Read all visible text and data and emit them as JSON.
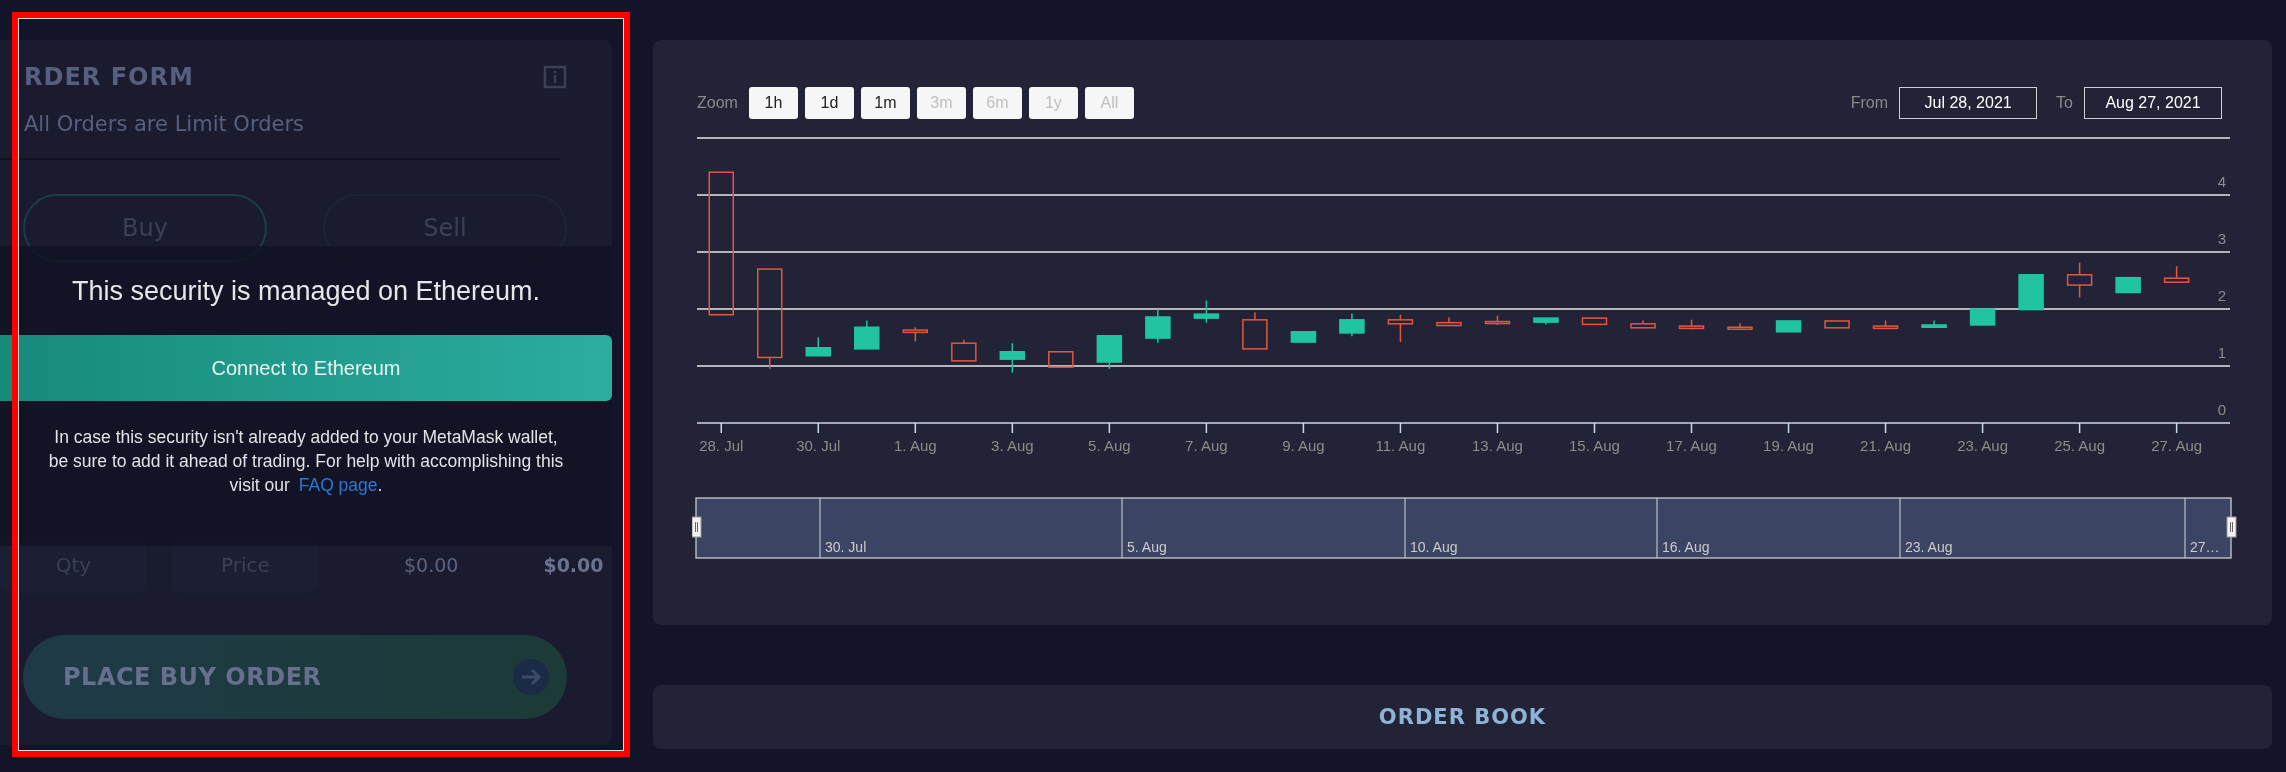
{
  "order_form": {
    "title": "RDER FORM",
    "subtitle": "All Orders are Limit Orders",
    "tabs": [
      {
        "label": "Buy",
        "selected": true
      },
      {
        "label": "Sell",
        "selected": false
      }
    ],
    "quantity": {
      "placeholder": "Qty"
    },
    "price": {
      "placeholder": "Price"
    },
    "commission": "$0.00",
    "total": "$0.00",
    "submit": {
      "label": "PLACE BUY ORDER",
      "disabled": true
    }
  },
  "network_prompt": {
    "title": "This security is managed on Ethereum.",
    "button": "Connect to Ethereum",
    "message": "In case this security isn't already added to your MetaMask wallet, be sure to add it ahead of trading. For help with accomplishing this visit our",
    "link": "FAQ page",
    "after_link": "."
  },
  "chart": {
    "zoom_label": "Zoom",
    "zoom_buttons": [
      {
        "label": "1h",
        "disabled": false
      },
      {
        "label": "1d",
        "disabled": false
      },
      {
        "label": "1m",
        "disabled": false
      },
      {
        "label": "3m",
        "disabled": true
      },
      {
        "label": "6m",
        "disabled": true
      },
      {
        "label": "1y",
        "disabled": true
      },
      {
        "label": "All",
        "disabled": true
      }
    ],
    "from_label": "From",
    "from": "Jul 28, 2021",
    "to_label": "To",
    "to": "Aug 27, 2021",
    "chart_data": {
      "type": "candlestick",
      "grid": true,
      "ylim": [
        0,
        5
      ],
      "categories": [
        "28. Jul",
        null,
        "30. Jul",
        null,
        "1. Aug",
        null,
        "3. Aug",
        null,
        "5. Aug",
        null,
        "7. Aug",
        null,
        "9. Aug",
        null,
        "11. Aug",
        null,
        "13. Aug",
        null,
        "15. Aug",
        null,
        "17. Aug",
        null,
        "19. Aug",
        null,
        "21. Aug",
        null,
        "23. Aug",
        null,
        "25. Aug",
        null,
        "27. Aug"
      ],
      "yticks": [
        0,
        1,
        2,
        3,
        4
      ],
      "ohlc": [
        [
          4.4,
          4.4,
          1.9,
          1.9
        ],
        [
          2.7,
          2.7,
          0.95,
          1.15
        ],
        [
          1.18,
          1.5,
          1.17,
          1.32
        ],
        [
          1.3,
          1.8,
          1.3,
          1.68
        ],
        [
          1.63,
          1.68,
          1.43,
          1.59
        ],
        [
          1.4,
          1.46,
          1.09,
          1.09
        ],
        [
          1.12,
          1.4,
          0.88,
          1.25
        ],
        [
          1.25,
          1.25,
          0.98,
          0.98
        ],
        [
          1.07,
          1.53,
          0.95,
          1.53
        ],
        [
          1.49,
          2.0,
          1.41,
          1.86
        ],
        [
          1.84,
          2.15,
          1.76,
          1.91
        ],
        [
          1.81,
          1.94,
          1.3,
          1.3
        ],
        [
          1.42,
          1.6,
          1.42,
          1.6
        ],
        [
          1.58,
          1.92,
          1.52,
          1.81
        ],
        [
          1.81,
          1.9,
          1.42,
          1.74
        ],
        [
          1.76,
          1.85,
          1.71,
          1.71
        ],
        [
          1.78,
          1.88,
          1.72,
          1.75
        ],
        [
          1.77,
          1.84,
          1.73,
          1.84
        ],
        [
          1.84,
          1.84,
          1.73,
          1.73
        ],
        [
          1.74,
          1.8,
          1.67,
          1.67
        ],
        [
          1.7,
          1.81,
          1.64,
          1.66
        ],
        [
          1.68,
          1.75,
          1.63,
          1.65
        ],
        [
          1.6,
          1.79,
          1.6,
          1.79
        ],
        [
          1.79,
          1.79,
          1.67,
          1.67
        ],
        [
          1.7,
          1.8,
          1.66,
          1.66
        ],
        [
          1.68,
          1.8,
          1.68,
          1.72
        ],
        [
          1.72,
          2.0,
          1.72,
          2.0
        ],
        [
          1.99,
          2.6,
          1.99,
          2.6
        ],
        [
          2.6,
          2.81,
          2.2,
          2.42
        ],
        [
          2.29,
          2.55,
          2.29,
          2.55
        ],
        [
          2.54,
          2.75,
          2.47,
          2.47
        ]
      ]
    },
    "navigator": {
      "labels": [
        "30. Jul",
        "5. Aug",
        "10. Aug",
        "16. Aug",
        "23. Aug",
        "27…"
      ]
    }
  },
  "order_book": {
    "title": "ORDER BOOK"
  }
}
